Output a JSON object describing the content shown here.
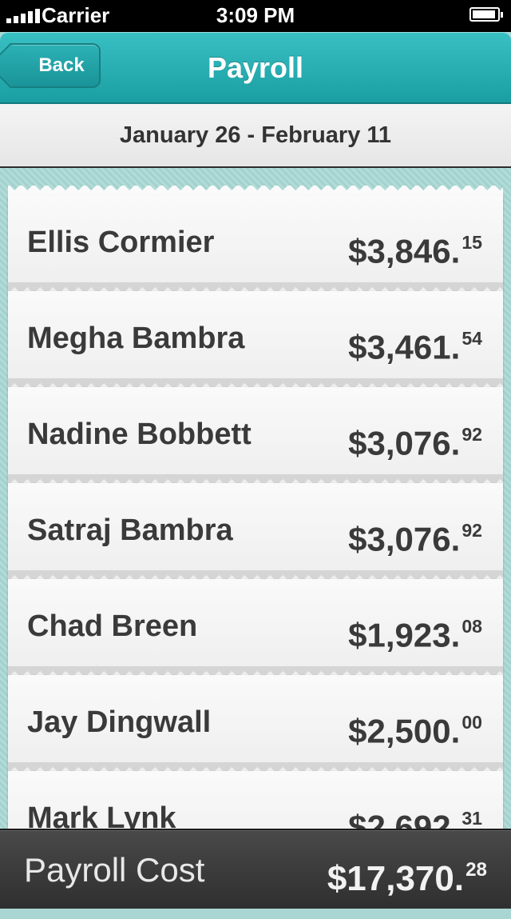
{
  "status_bar": {
    "carrier": "Carrier",
    "time": "3:09 PM",
    "signal_icon": "signal-bars-icon",
    "battery_icon": "battery-icon"
  },
  "nav": {
    "back_label": "Back",
    "title": "Payroll",
    "accent_color": "#25adb1"
  },
  "period": {
    "label": "January 26 - February 11"
  },
  "employees": [
    {
      "name": "Ellis Cormier",
      "amount_main": "$3,846.",
      "amount_cents": "15"
    },
    {
      "name": "Megha Bambra",
      "amount_main": "$3,461.",
      "amount_cents": "54"
    },
    {
      "name": "Nadine Bobbett",
      "amount_main": "$3,076.",
      "amount_cents": "92"
    },
    {
      "name": "Satraj Bambra",
      "amount_main": "$3,076.",
      "amount_cents": "92"
    },
    {
      "name": "Chad Breen",
      "amount_main": "$1,923.",
      "amount_cents": "08"
    },
    {
      "name": "Jay Dingwall",
      "amount_main": "$2,500.",
      "amount_cents": "00"
    },
    {
      "name": "Mark Lynk",
      "amount_main": "$2,692.",
      "amount_cents": "31"
    }
  ],
  "footer": {
    "label": "Payroll Cost",
    "total_main": "$17,370.",
    "total_cents": "28"
  }
}
